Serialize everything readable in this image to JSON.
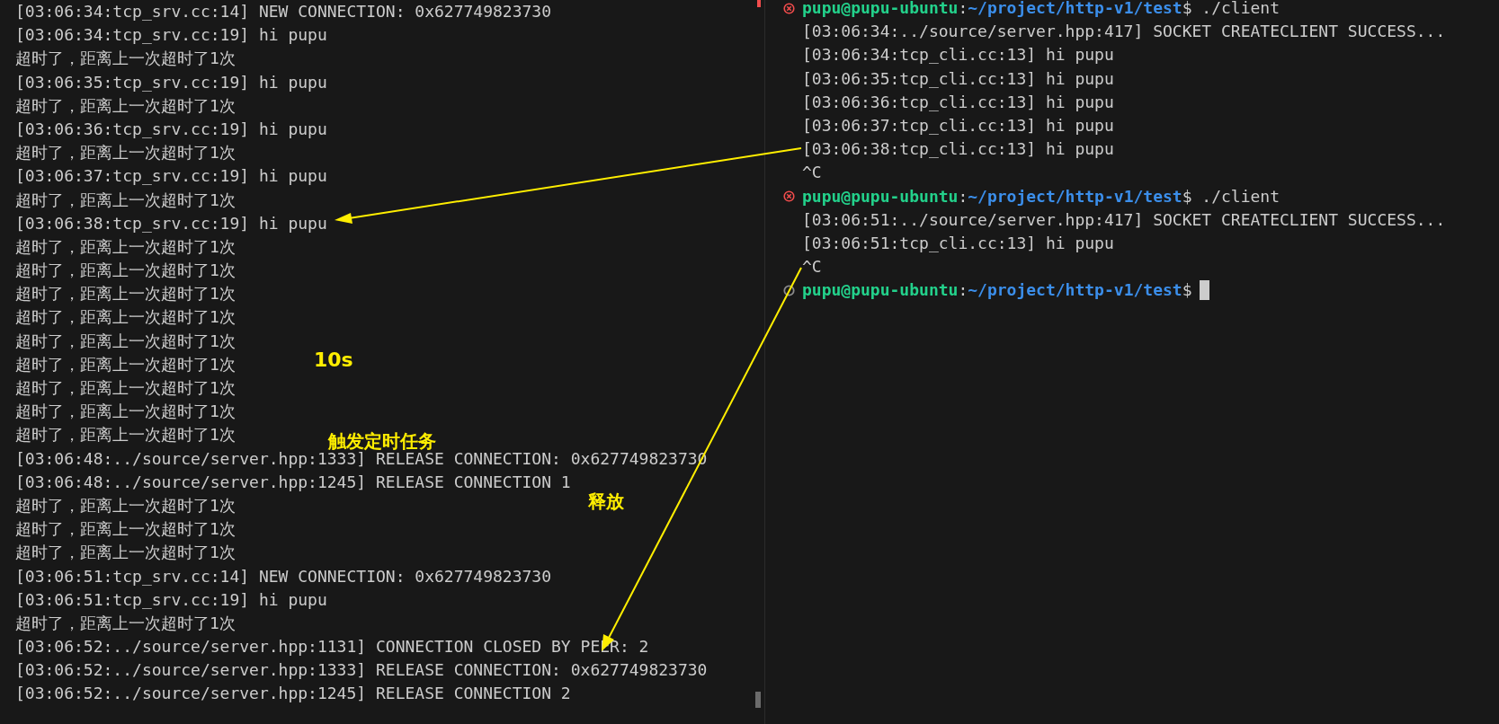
{
  "server_terminal": {
    "lines": [
      {
        "text": "[03:06:34:tcp_srv.cc:14] NEW CONNECTION: 0x627749823730"
      },
      {
        "text": "[03:06:34:tcp_srv.cc:19] hi pupu"
      },
      {
        "text": "超时了，距离上一次超时了1次"
      },
      {
        "text": "[03:06:35:tcp_srv.cc:19] hi pupu"
      },
      {
        "text": "超时了，距离上一次超时了1次"
      },
      {
        "text": "[03:06:36:tcp_srv.cc:19] hi pupu"
      },
      {
        "text": "超时了，距离上一次超时了1次"
      },
      {
        "text": "[03:06:37:tcp_srv.cc:19] hi pupu"
      },
      {
        "text": "超时了，距离上一次超时了1次"
      },
      {
        "text": "[03:06:38:tcp_srv.cc:19] hi pupu"
      },
      {
        "text": "超时了，距离上一次超时了1次"
      },
      {
        "text": "超时了，距离上一次超时了1次"
      },
      {
        "text": "超时了，距离上一次超时了1次"
      },
      {
        "text": "超时了，距离上一次超时了1次"
      },
      {
        "text": "超时了，距离上一次超时了1次"
      },
      {
        "text": "超时了，距离上一次超时了1次"
      },
      {
        "text": "超时了，距离上一次超时了1次"
      },
      {
        "text": "超时了，距离上一次超时了1次"
      },
      {
        "text": "超时了，距离上一次超时了1次"
      },
      {
        "text": "[03:06:48:../source/server.hpp:1333] RELEASE CONNECTION: 0x627749823730"
      },
      {
        "text": "[03:06:48:../source/server.hpp:1245] RELEASE CONNECTION 1"
      },
      {
        "text": "超时了，距离上一次超时了1次"
      },
      {
        "text": "超时了，距离上一次超时了1次"
      },
      {
        "text": "超时了，距离上一次超时了1次"
      },
      {
        "text": "[03:06:51:tcp_srv.cc:14] NEW CONNECTION: 0x627749823730"
      },
      {
        "text": "[03:06:51:tcp_srv.cc:19] hi pupu"
      },
      {
        "text": "超时了，距离上一次超时了1次"
      },
      {
        "text": "[03:06:52:../source/server.hpp:1131] CONNECTION CLOSED BY PEER: 2"
      },
      {
        "text": "[03:06:52:../source/server.hpp:1333] RELEASE CONNECTION: 0x627749823730"
      },
      {
        "text": "[03:06:52:../source/server.hpp:1245] RELEASE CONNECTION 2"
      }
    ]
  },
  "client_terminal": {
    "lines": [
      {
        "kind": "prompt",
        "failed": true,
        "user_host": "pupu@pupu-ubuntu",
        "separator": ":",
        "path": "~/project/http-v1/test",
        "command": "$ ./client",
        "cursor": false
      },
      {
        "kind": "output",
        "text": "[03:06:34:../source/server.hpp:417] SOCKET CREATECLIENT SUCCESS..."
      },
      {
        "kind": "output",
        "text": "[03:06:34:tcp_cli.cc:13] hi pupu"
      },
      {
        "kind": "output",
        "text": "[03:06:35:tcp_cli.cc:13] hi pupu"
      },
      {
        "kind": "output",
        "text": "[03:06:36:tcp_cli.cc:13] hi pupu"
      },
      {
        "kind": "output",
        "text": "[03:06:37:tcp_cli.cc:13] hi pupu"
      },
      {
        "kind": "output",
        "text": "[03:06:38:tcp_cli.cc:13] hi pupu"
      },
      {
        "kind": "output",
        "text": "^C"
      },
      {
        "kind": "prompt",
        "failed": true,
        "user_host": "pupu@pupu-ubuntu",
        "separator": ":",
        "path": "~/project/http-v1/test",
        "command": "$ ./client",
        "cursor": false
      },
      {
        "kind": "output",
        "text": "[03:06:51:../source/server.hpp:417] SOCKET CREATECLIENT SUCCESS..."
      },
      {
        "kind": "output",
        "text": "[03:06:51:tcp_cli.cc:13] hi pupu"
      },
      {
        "kind": "output",
        "text": "^C"
      },
      {
        "kind": "prompt",
        "failed": false,
        "user_host": "pupu@pupu-ubuntu",
        "separator": ":",
        "path": "~/project/http-v1/test",
        "command": "$",
        "cursor": true
      }
    ]
  },
  "annotations": [
    {
      "text": "10s"
    },
    {
      "text": "触发定时任务"
    },
    {
      "text": "释放"
    }
  ]
}
